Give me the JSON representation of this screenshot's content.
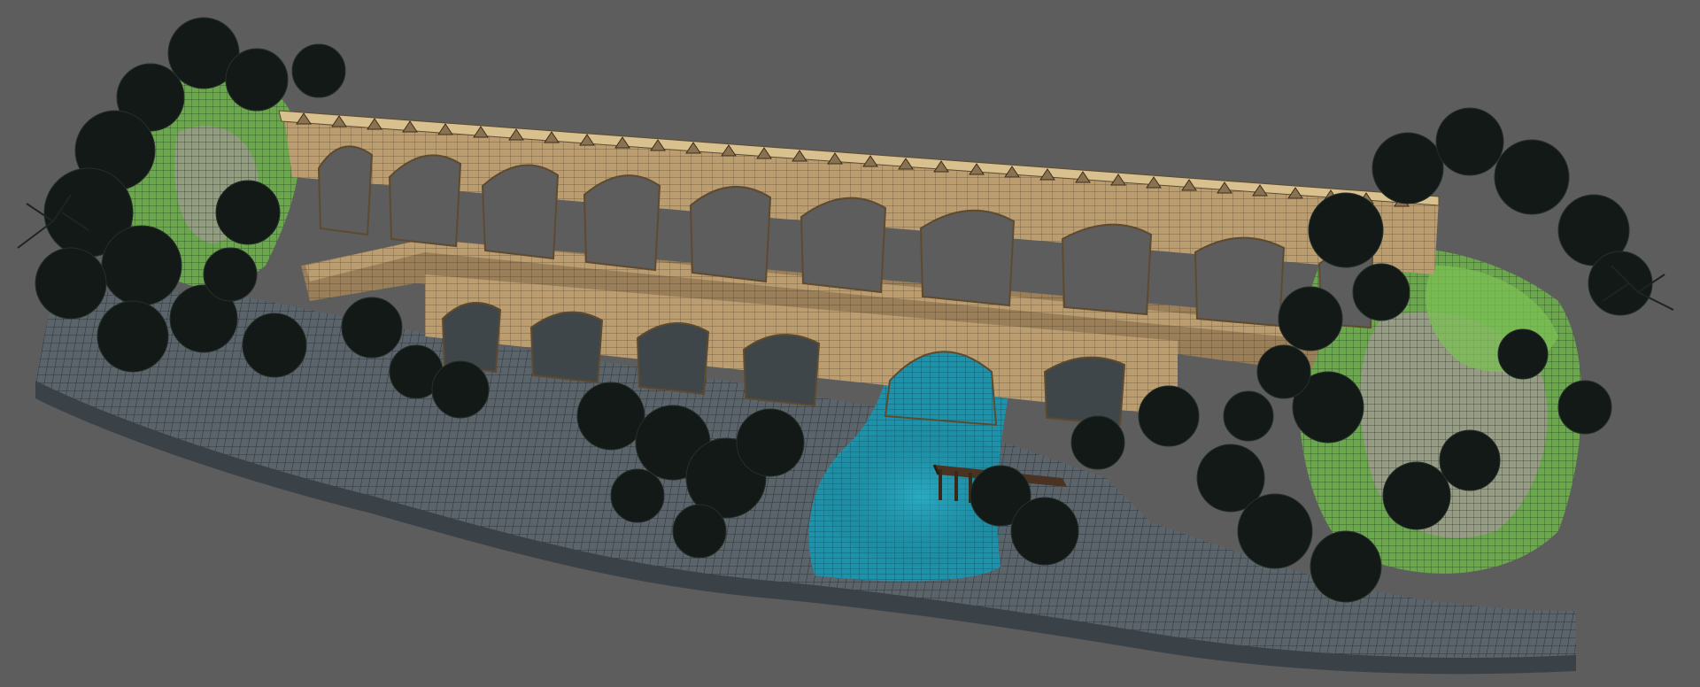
{
  "viewport": {
    "background": "#5d5d5d"
  },
  "scene": {
    "description_free": true,
    "palette": {
      "ground": "#59626a",
      "ground_dark": "#3e464c",
      "wire": "#1b1f22",
      "moss": "#6bb04a",
      "moss_light": "#9bd06a",
      "rock_pink": "#b9a2a8",
      "stone": "#b89a6e",
      "stone_dark": "#8a7250",
      "stone_light": "#d2b88c",
      "water": "#1a8ea6",
      "water_light": "#2fb6cf",
      "foliage": "#141a16",
      "foliage_edge": "#222b24"
    },
    "icons": {
      "dock": "wooden-dock-icon"
    }
  }
}
